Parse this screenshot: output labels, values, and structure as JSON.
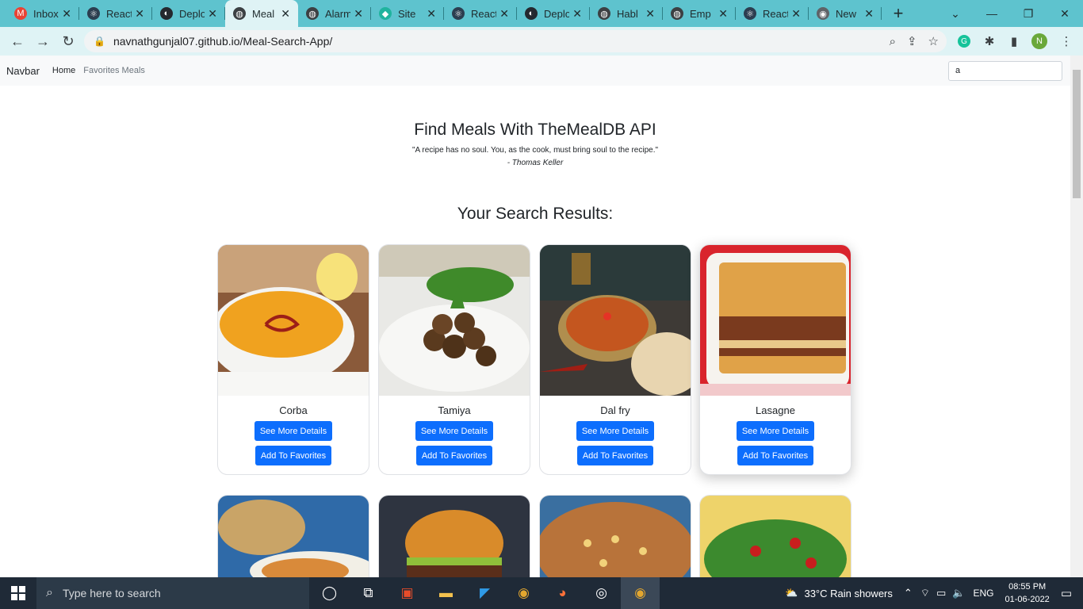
{
  "browser": {
    "tabs": [
      {
        "title": "Inbox",
        "icon": "gmail-icon",
        "color": "#ea4335",
        "glyph": "M"
      },
      {
        "title": "React",
        "icon": "react-icon",
        "color": "#2c3e50",
        "glyph": "⚛"
      },
      {
        "title": "Deploy",
        "icon": "github-icon",
        "color": "#24292f",
        "glyph": "◐"
      },
      {
        "title": "Meal",
        "icon": "globe-icon",
        "color": "#3c4043",
        "glyph": "◍",
        "active": true
      },
      {
        "title": "Alarm",
        "icon": "globe-icon",
        "color": "#3c4043",
        "glyph": "◍"
      },
      {
        "title": "Site",
        "icon": "netlify-icon",
        "color": "#20b39e",
        "glyph": "◆"
      },
      {
        "title": "React",
        "icon": "react-icon",
        "color": "#2c3e50",
        "glyph": "⚛"
      },
      {
        "title": "Deploy",
        "icon": "github-icon",
        "color": "#24292f",
        "glyph": "◐"
      },
      {
        "title": "Habl",
        "icon": "globe-icon",
        "color": "#3c4043",
        "glyph": "◍"
      },
      {
        "title": "Emp",
        "icon": "globe-icon",
        "color": "#3c4043",
        "glyph": "◍"
      },
      {
        "title": "React",
        "icon": "react-icon",
        "color": "#2c3e50",
        "glyph": "⚛"
      },
      {
        "title": "New",
        "icon": "chrome-icon",
        "color": "#5f6368",
        "glyph": "◉"
      }
    ],
    "url": "navnathgunjal07.github.io/Meal-Search-App/",
    "profile_initial": "N"
  },
  "navbar": {
    "brand": "Navbar",
    "home": "Home",
    "favorites": "Favorites Meals",
    "search_value": "a"
  },
  "hero": {
    "title": "Find Meals With TheMealDB API",
    "quote": "\"A recipe has no soul. You, as the cook, must bring soul to the recipe.\"",
    "author": "- Thomas Keller"
  },
  "results": {
    "title": "Your Search Results:",
    "details_label": "See More Details",
    "favorites_label": "Add To Favorites",
    "meals": [
      {
        "name": "Corba"
      },
      {
        "name": "Tamiya"
      },
      {
        "name": "Dal fry"
      },
      {
        "name": "Lasagne"
      }
    ]
  },
  "taskbar": {
    "search_placeholder": "Type here to search",
    "weather": "33°C  Rain showers",
    "language": "ENG",
    "time": "08:55 PM",
    "date": "01-06-2022"
  },
  "colors": {
    "primary": "#0d6efd",
    "tabbar": "#5ec3ce"
  }
}
